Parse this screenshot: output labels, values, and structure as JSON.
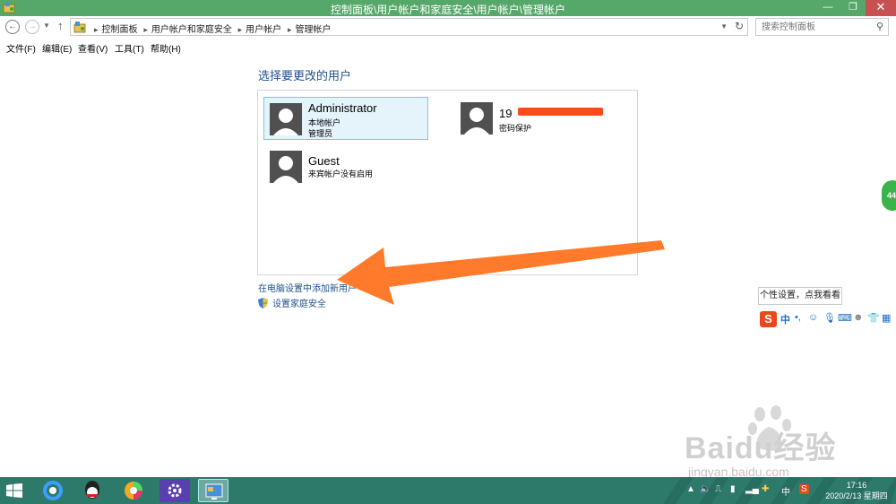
{
  "window": {
    "title": "控制面板\\用户帐户和家庭安全\\用户帐户\\管理帐户",
    "min_label": "—",
    "max_label": "❐",
    "close_label": "✕"
  },
  "nav": {
    "back": "←",
    "forward": "→",
    "up": "↑",
    "breadcrumb": [
      "控制面板",
      "用户帐户和家庭安全",
      "用户帐户",
      "管理帐户"
    ],
    "search_placeholder": "搜索控制面板"
  },
  "menu": [
    "文件(F)",
    "编辑(E)",
    "查看(V)",
    "工具(T)",
    "帮助(H)"
  ],
  "main": {
    "heading": "选择要更改的用户",
    "accounts": [
      {
        "name": "Administrator",
        "lines": [
          "本地帐户",
          "管理员"
        ],
        "selected": true
      },
      {
        "name": "19",
        "lines": [
          "密码保护"
        ],
        "selected": false
      },
      {
        "name": "Guest",
        "lines": [
          "来宾帐户没有启用"
        ],
        "selected": false
      }
    ],
    "link_add_user": "在电脑设置中添加新用户",
    "link_family_safety": "设置家庭安全"
  },
  "ime": {
    "tooltip": "个性设置，点我看看",
    "logo": "S",
    "mode": "中"
  },
  "watermark": {
    "main": "Baidu经验",
    "sub": "jingyan.baidu.com"
  },
  "taskbar": {
    "ime_mode": "中",
    "time": "17:16",
    "date": "2020/2/13 星期四"
  },
  "colors": {
    "titlebar": "#56a86a",
    "taskbar": "#2d7a6a",
    "link": "#1e4f8c",
    "arrow": "#ff7a2b",
    "selected_bg": "#e5f3fb"
  },
  "icons": [
    "control-panel-icon",
    "search-icon",
    "refresh-icon",
    "shield-icon",
    "windows-start-icon"
  ]
}
